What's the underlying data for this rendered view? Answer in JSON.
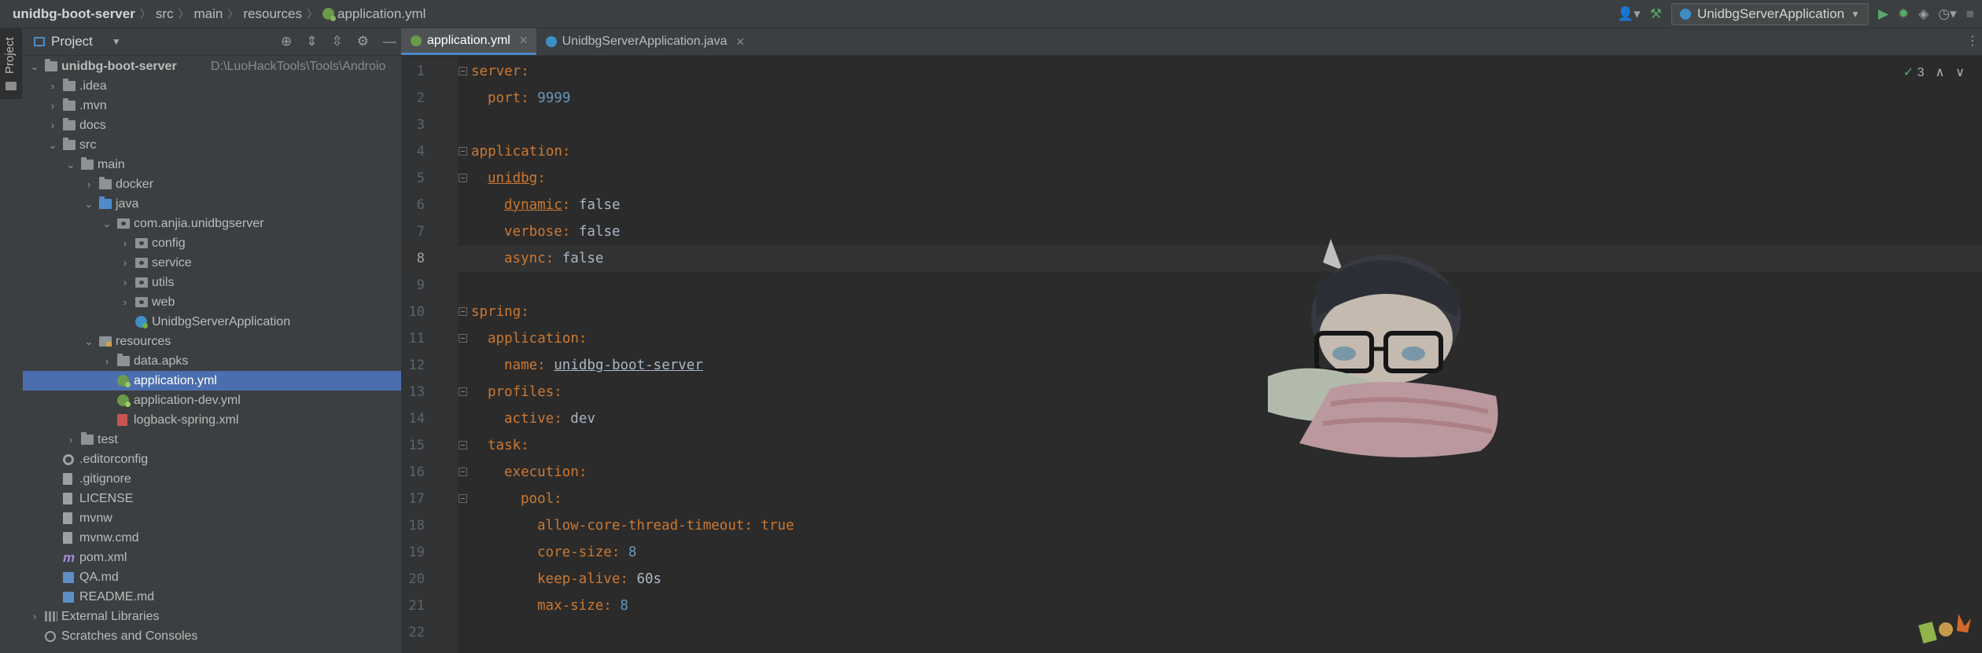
{
  "breadcrumb": {
    "project": "unidbg-boot-server",
    "parts": [
      "src",
      "main",
      "resources"
    ],
    "file": "application.yml"
  },
  "toolbar": {
    "run_config": "UnidbgServerApplication",
    "icons": [
      "user-icon",
      "build-hammer-icon",
      "run-icon",
      "debug-icon",
      "coverage-icon",
      "profile-icon",
      "stop-icon"
    ]
  },
  "side_strip": {
    "label": "Project"
  },
  "project_panel": {
    "title": "Project",
    "header_icons": [
      "locate-icon",
      "expand-all-icon",
      "collapse-all-icon",
      "gear-icon",
      "hide-icon"
    ]
  },
  "tree": [
    {
      "label": "unidbg-boot-server",
      "path": "D:\\LuoHackTools\\Tools\\Androio",
      "depth": 0,
      "arrow": "down",
      "icon": "folder",
      "bold": true
    },
    {
      "label": ".idea",
      "depth": 1,
      "arrow": "right",
      "icon": "folder"
    },
    {
      "label": ".mvn",
      "depth": 1,
      "arrow": "right",
      "icon": "folder"
    },
    {
      "label": "docs",
      "depth": 1,
      "arrow": "right",
      "icon": "folder"
    },
    {
      "label": "src",
      "depth": 1,
      "arrow": "down",
      "icon": "folder"
    },
    {
      "label": "main",
      "depth": 2,
      "arrow": "down",
      "icon": "folder"
    },
    {
      "label": "docker",
      "depth": 3,
      "arrow": "right",
      "icon": "folder"
    },
    {
      "label": "java",
      "depth": 3,
      "arrow": "down",
      "icon": "folder-blue"
    },
    {
      "label": "com.anjia.unidbgserver",
      "depth": 4,
      "arrow": "down",
      "icon": "pkg"
    },
    {
      "label": "config",
      "depth": 5,
      "arrow": "right",
      "icon": "pkg"
    },
    {
      "label": "service",
      "depth": 5,
      "arrow": "right",
      "icon": "pkg"
    },
    {
      "label": "utils",
      "depth": 5,
      "arrow": "right",
      "icon": "pkg"
    },
    {
      "label": "web",
      "depth": 5,
      "arrow": "right",
      "icon": "pkg"
    },
    {
      "label": "UnidbgServerApplication",
      "depth": 5,
      "arrow": "",
      "icon": "spring"
    },
    {
      "label": "resources",
      "depth": 3,
      "arrow": "down",
      "icon": "folder-res"
    },
    {
      "label": "data.apks",
      "depth": 4,
      "arrow": "right",
      "icon": "folder"
    },
    {
      "label": "application.yml",
      "depth": 4,
      "arrow": "",
      "icon": "yml",
      "selected": true
    },
    {
      "label": "application-dev.yml",
      "depth": 4,
      "arrow": "",
      "icon": "yml"
    },
    {
      "label": "logback-spring.xml",
      "depth": 4,
      "arrow": "",
      "icon": "xml"
    },
    {
      "label": "test",
      "depth": 2,
      "arrow": "right",
      "icon": "folder"
    },
    {
      "label": ".editorconfig",
      "depth": 1,
      "arrow": "",
      "icon": "gear"
    },
    {
      "label": ".gitignore",
      "depth": 1,
      "arrow": "",
      "icon": "file"
    },
    {
      "label": "LICENSE",
      "depth": 1,
      "arrow": "",
      "icon": "file"
    },
    {
      "label": "mvnw",
      "depth": 1,
      "arrow": "",
      "icon": "file"
    },
    {
      "label": "mvnw.cmd",
      "depth": 1,
      "arrow": "",
      "icon": "file"
    },
    {
      "label": "pom.xml",
      "depth": 1,
      "arrow": "",
      "icon": "maven"
    },
    {
      "label": "QA.md",
      "depth": 1,
      "arrow": "",
      "icon": "md"
    },
    {
      "label": "README.md",
      "depth": 1,
      "arrow": "",
      "icon": "md"
    },
    {
      "label": "External Libraries",
      "depth": 0,
      "arrow": "right",
      "icon": "lib"
    },
    {
      "label": "Scratches and Consoles",
      "depth": 0,
      "arrow": "",
      "icon": "scratch"
    }
  ],
  "tabs": [
    {
      "label": "application.yml",
      "active": true,
      "icon": "yml"
    },
    {
      "label": "UnidbgServerApplication.java",
      "active": false,
      "icon": "java"
    }
  ],
  "inspections": {
    "count": "3"
  },
  "code_lines": [
    {
      "n": "1",
      "indent": 0,
      "key": "server",
      "sep": ":",
      "value": "",
      "vtype": ""
    },
    {
      "n": "2",
      "indent": 1,
      "key": "port",
      "sep": ": ",
      "value": "9999",
      "vtype": "num"
    },
    {
      "n": "3",
      "indent": 0,
      "key": "",
      "sep": "",
      "value": "",
      "vtype": ""
    },
    {
      "n": "4",
      "indent": 0,
      "key": "application",
      "sep": ":",
      "value": "",
      "vtype": ""
    },
    {
      "n": "5",
      "indent": 1,
      "key": "unidbg",
      "sep": ":",
      "value": "",
      "vtype": "",
      "underline": true
    },
    {
      "n": "6",
      "indent": 2,
      "key": "dynamic",
      "sep": ": ",
      "value": "false",
      "vtype": "str",
      "underline": true
    },
    {
      "n": "7",
      "indent": 2,
      "key": "verbose",
      "sep": ": ",
      "value": "false",
      "vtype": "str"
    },
    {
      "n": "8",
      "indent": 2,
      "key": "async",
      "sep": ": ",
      "value": "false",
      "vtype": "str",
      "current": true
    },
    {
      "n": "9",
      "indent": 0,
      "key": "",
      "sep": "",
      "value": "",
      "vtype": ""
    },
    {
      "n": "10",
      "indent": 0,
      "key": "spring",
      "sep": ":",
      "value": "",
      "vtype": ""
    },
    {
      "n": "11",
      "indent": 1,
      "key": "application",
      "sep": ":",
      "value": "",
      "vtype": ""
    },
    {
      "n": "12",
      "indent": 2,
      "key": "name",
      "sep": ": ",
      "value": "unidbg-boot-server",
      "vtype": "str",
      "value_underline": true
    },
    {
      "n": "13",
      "indent": 1,
      "key": "profiles",
      "sep": ":",
      "value": "",
      "vtype": ""
    },
    {
      "n": "14",
      "indent": 2,
      "key": "active",
      "sep": ": ",
      "value": "dev",
      "vtype": "str"
    },
    {
      "n": "15",
      "indent": 1,
      "key": "task",
      "sep": ":",
      "value": "",
      "vtype": ""
    },
    {
      "n": "16",
      "indent": 2,
      "key": "execution",
      "sep": ":",
      "value": "",
      "vtype": ""
    },
    {
      "n": "17",
      "indent": 3,
      "key": "pool",
      "sep": ":",
      "value": "",
      "vtype": ""
    },
    {
      "n": "18",
      "indent": 4,
      "key": "allow-core-thread-timeout",
      "sep": ": ",
      "value": "true",
      "vtype": "kw"
    },
    {
      "n": "19",
      "indent": 4,
      "key": "core-size",
      "sep": ": ",
      "value": "8",
      "vtype": "num"
    },
    {
      "n": "20",
      "indent": 4,
      "key": "keep-alive",
      "sep": ": ",
      "value": "60s",
      "vtype": "str"
    },
    {
      "n": "21",
      "indent": 4,
      "key": "max-size",
      "sep": ": ",
      "value": "8",
      "vtype": "num"
    },
    {
      "n": "22",
      "indent": 0,
      "key": "",
      "sep": "",
      "value": "",
      "vtype": ""
    }
  ],
  "colors": {
    "background": "#2b2b2b",
    "panel": "#3c3f41",
    "selection": "#4b6eaf",
    "key": "#cc7832",
    "number": "#6897bb",
    "string": "#a9b7c6"
  }
}
